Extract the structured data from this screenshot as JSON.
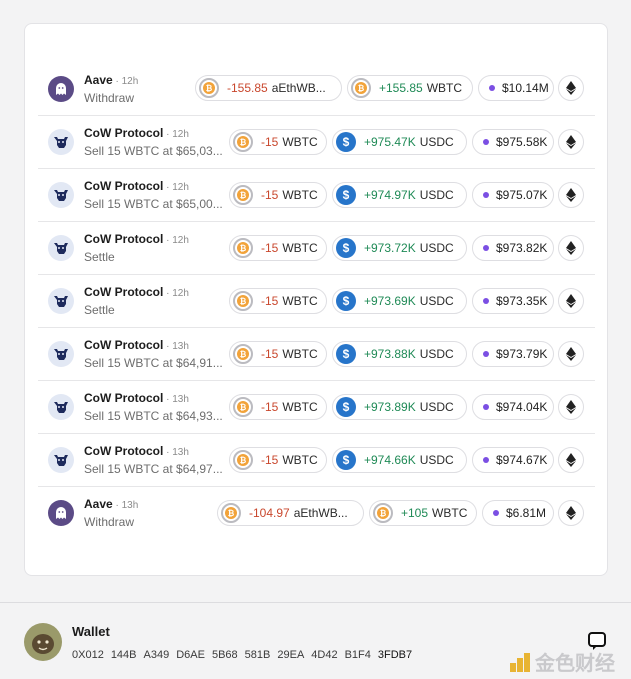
{
  "transactions": [
    {
      "protocol": "Aave",
      "time": "12h",
      "action": "Withdraw",
      "icon": "aave-ghost-icon",
      "out": {
        "amount": "-155.85",
        "symbol": "aEthWB...",
        "token": "wbtc"
      },
      "in": {
        "amount": "+155.85",
        "symbol": "WBTC",
        "token": "wbtc"
      },
      "value": "$10.14M",
      "chain": "ethereum-icon"
    },
    {
      "protocol": "CoW Protocol",
      "time": "12h",
      "action": "Sell 15 WBTC at $65,03...",
      "icon": "cow-icon",
      "out": {
        "amount": "-15",
        "symbol": "WBTC",
        "token": "wbtc"
      },
      "in": {
        "amount": "+975.47K",
        "symbol": "USDC",
        "token": "usdc"
      },
      "value": "$975.58K",
      "chain": "ethereum-icon"
    },
    {
      "protocol": "CoW Protocol",
      "time": "12h",
      "action": "Sell 15 WBTC at $65,00...",
      "icon": "cow-icon",
      "out": {
        "amount": "-15",
        "symbol": "WBTC",
        "token": "wbtc"
      },
      "in": {
        "amount": "+974.97K",
        "symbol": "USDC",
        "token": "usdc"
      },
      "value": "$975.07K",
      "chain": "ethereum-icon"
    },
    {
      "protocol": "CoW Protocol",
      "time": "12h",
      "action": "Settle",
      "icon": "cow-icon",
      "out": {
        "amount": "-15",
        "symbol": "WBTC",
        "token": "wbtc"
      },
      "in": {
        "amount": "+973.72K",
        "symbol": "USDC",
        "token": "usdc"
      },
      "value": "$973.82K",
      "chain": "ethereum-icon"
    },
    {
      "protocol": "CoW Protocol",
      "time": "12h",
      "action": "Settle",
      "icon": "cow-icon",
      "out": {
        "amount": "-15",
        "symbol": "WBTC",
        "token": "wbtc"
      },
      "in": {
        "amount": "+973.69K",
        "symbol": "USDC",
        "token": "usdc"
      },
      "value": "$973.35K",
      "chain": "ethereum-icon"
    },
    {
      "protocol": "CoW Protocol",
      "time": "13h",
      "action": "Sell 15 WBTC at $64,91...",
      "icon": "cow-icon",
      "out": {
        "amount": "-15",
        "symbol": "WBTC",
        "token": "wbtc"
      },
      "in": {
        "amount": "+973.88K",
        "symbol": "USDC",
        "token": "usdc"
      },
      "value": "$973.79K",
      "chain": "ethereum-icon"
    },
    {
      "protocol": "CoW Protocol",
      "time": "13h",
      "action": "Sell 15 WBTC at $64,93...",
      "icon": "cow-icon",
      "out": {
        "amount": "-15",
        "symbol": "WBTC",
        "token": "wbtc"
      },
      "in": {
        "amount": "+973.89K",
        "symbol": "USDC",
        "token": "usdc"
      },
      "value": "$974.04K",
      "chain": "ethereum-icon"
    },
    {
      "protocol": "CoW Protocol",
      "time": "13h",
      "action": "Sell 15 WBTC at $64,97...",
      "icon": "cow-icon",
      "out": {
        "amount": "-15",
        "symbol": "WBTC",
        "token": "wbtc"
      },
      "in": {
        "amount": "+974.66K",
        "symbol": "USDC",
        "token": "usdc"
      },
      "value": "$974.67K",
      "chain": "ethereum-icon"
    },
    {
      "protocol": "Aave",
      "time": "13h",
      "action": "Withdraw",
      "icon": "aave-ghost-icon",
      "out": {
        "amount": "-104.97",
        "symbol": "aEthWB...",
        "token": "wbtc"
      },
      "in": {
        "amount": "+105",
        "symbol": "WBTC",
        "token": "wbtc"
      },
      "value": "$6.81M",
      "chain": "ethereum-icon"
    }
  ],
  "wallet": {
    "title": "Wallet",
    "address_groups": [
      "0X012",
      "144B",
      "A349",
      "D6AE",
      "5B68",
      "581B",
      "29EA",
      "4D42",
      "B1F4",
      "3FDB7"
    ]
  },
  "watermark": {
    "text": "金色财经"
  },
  "colors": {
    "negative": "#c9472d",
    "positive": "#1f8a56",
    "value_dot": "#7b4fe3",
    "usdc": "#2775ca",
    "btc": "#f2a33a"
  }
}
